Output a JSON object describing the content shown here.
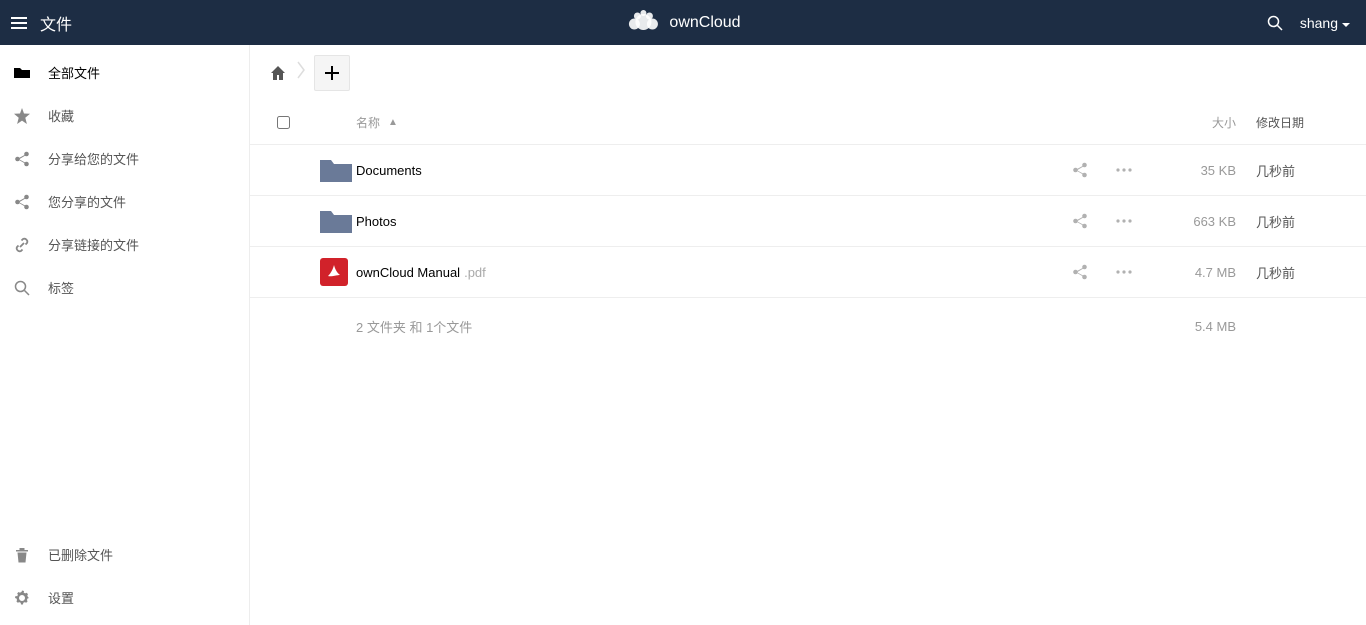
{
  "header": {
    "app_title": "文件",
    "brand": "ownCloud",
    "user": "shang"
  },
  "sidebar": {
    "items": [
      {
        "label": "全部文件"
      },
      {
        "label": "收藏"
      },
      {
        "label": "分享给您的文件"
      },
      {
        "label": "您分享的文件"
      },
      {
        "label": "分享链接的文件"
      },
      {
        "label": "标签"
      }
    ],
    "bottom": [
      {
        "label": "已删除文件"
      },
      {
        "label": "设置"
      }
    ]
  },
  "table": {
    "headers": {
      "name": "名称",
      "size": "大小",
      "modified": "修改日期"
    },
    "rows": [
      {
        "name": "Documents",
        "ext": "",
        "type": "folder",
        "size": "35 KB",
        "date": "几秒前"
      },
      {
        "name": "Photos",
        "ext": "",
        "type": "folder",
        "size": "663 KB",
        "date": "几秒前"
      },
      {
        "name": "ownCloud Manual",
        "ext": ".pdf",
        "type": "pdf",
        "size": "4.7 MB",
        "date": "几秒前"
      }
    ],
    "summary": {
      "text": "2 文件夹 和 1个文件",
      "size": "5.4 MB"
    }
  }
}
